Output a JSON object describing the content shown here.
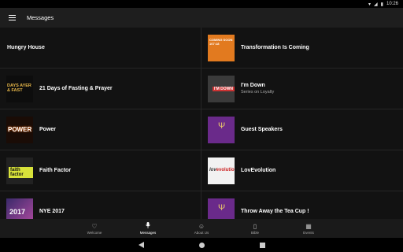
{
  "status": {
    "time": "10:26"
  },
  "appbar": {
    "title": "Messages"
  },
  "messages": [
    {
      "title": "Hungry House",
      "subtitle": "",
      "thumb": ""
    },
    {
      "title": "Transformation Is Coming",
      "subtitle": "",
      "thumb": "COMING SOON 107:18"
    },
    {
      "title": "21 Days of Fasting & Prayer",
      "subtitle": "",
      "thumb": "DAYS AYER & FAST"
    },
    {
      "title": "I'm Down",
      "subtitle": "Series on Loyalty",
      "thumb": "I'M DOWN"
    },
    {
      "title": "Power",
      "subtitle": "",
      "thumb": "POWER"
    },
    {
      "title": "Guest Speakers",
      "subtitle": "",
      "thumb": "Ψ"
    },
    {
      "title": "Faith Factor",
      "subtitle": "",
      "thumb": "faith factor"
    },
    {
      "title": "LovEvolution",
      "subtitle": "",
      "thumb_a": "lov",
      "thumb_b": "evolution"
    },
    {
      "title": "NYE 2017",
      "subtitle": "",
      "thumb": "2017"
    },
    {
      "title": "Throw Away the Tea Cup !",
      "subtitle": "",
      "thumb": "Ψ"
    }
  ],
  "bottom_nav": [
    {
      "label": "Welcome",
      "icon": "heart-icon",
      "glyph": "♡"
    },
    {
      "label": "Messages",
      "icon": "microphone-icon",
      "glyph": "🎙"
    },
    {
      "label": "About Us",
      "icon": "smiley-icon",
      "glyph": "☺"
    },
    {
      "label": "Bible",
      "icon": "book-icon",
      "glyph": "▯"
    },
    {
      "label": "Events",
      "icon": "calendar-icon",
      "glyph": "▦"
    }
  ]
}
